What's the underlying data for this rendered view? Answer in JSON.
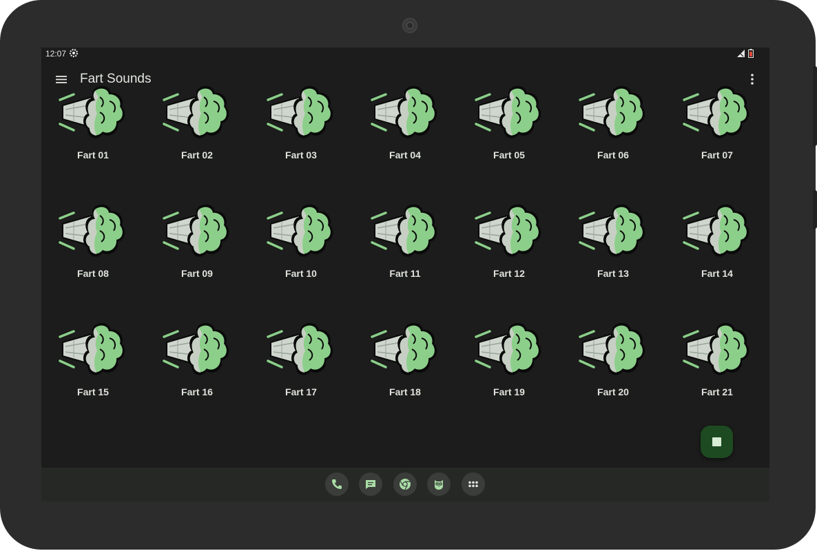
{
  "status_bar": {
    "time": "12:07"
  },
  "app_bar": {
    "title": "Fart Sounds"
  },
  "sounds": [
    "Fart 01",
    "Fart 02",
    "Fart 03",
    "Fart 04",
    "Fart 05",
    "Fart 06",
    "Fart 07",
    "Fart 08",
    "Fart 09",
    "Fart 10",
    "Fart 11",
    "Fart 12",
    "Fart 13",
    "Fart 14",
    "Fart 15",
    "Fart 16",
    "Fart 17",
    "Fart 18",
    "Fart 19",
    "Fart 20",
    "Fart 21"
  ],
  "icons": {
    "sound_tile": "fart-cloud-icon",
    "fab": "stop-icon",
    "menu": "hamburger-menu-icon",
    "overflow": "more-vert-icon",
    "dock": [
      "phone-icon",
      "messages-icon",
      "chrome-icon",
      "owl-app-icon",
      "app-drawer-icon"
    ]
  },
  "colors": {
    "background": "#1b1c1b",
    "accent_green": "#8ccf8a",
    "fab": "#1e4a22",
    "text": "#dfe3dc"
  }
}
